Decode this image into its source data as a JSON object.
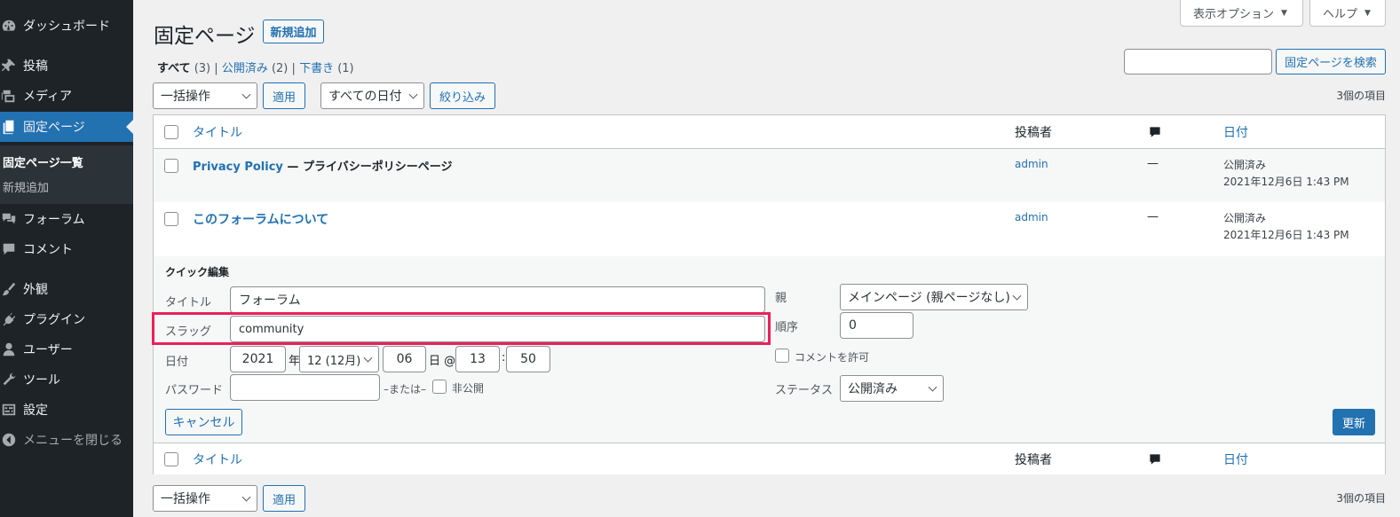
{
  "sidebar": {
    "items": [
      {
        "label": "ダッシュボード",
        "icon": "dashboard-icon"
      },
      {
        "label": "投稿",
        "icon": "pin-icon"
      },
      {
        "label": "メディア",
        "icon": "media-icon"
      },
      {
        "label": "固定ページ",
        "icon": "page-icon"
      },
      {
        "label": "フォーラム",
        "icon": "forum-icon"
      },
      {
        "label": "コメント",
        "icon": "comment-icon"
      },
      {
        "label": "外観",
        "icon": "brush-icon"
      },
      {
        "label": "プラグイン",
        "icon": "plugin-icon"
      },
      {
        "label": "ユーザー",
        "icon": "user-icon"
      },
      {
        "label": "ツール",
        "icon": "wrench-icon"
      },
      {
        "label": "設定",
        "icon": "settings-icon"
      },
      {
        "label": "メニューを閉じる",
        "icon": "collapse-icon"
      }
    ],
    "submenu": [
      "固定ページ一覧",
      "新規追加"
    ]
  },
  "header": {
    "screen_options": "表示オプション",
    "help": "ヘルプ",
    "title": "固定ページ",
    "add_new": "新規追加"
  },
  "filters": {
    "all": "すべて",
    "all_count": "(3)",
    "published": "公開済み",
    "published_count": "(2)",
    "draft": "下書き",
    "draft_count": "(1)",
    "sep": "|"
  },
  "search": {
    "value": "",
    "button": "固定ページを検索"
  },
  "bulk": {
    "action": "一括操作",
    "apply": "適用",
    "date": "すべての日付",
    "filter": "絞り込み",
    "count": "3個の項目"
  },
  "table": {
    "headers": {
      "title": "タイトル",
      "author": "投稿者",
      "date": "日付"
    },
    "rows": [
      {
        "title": "Privacy Policy",
        "state": " — プライバシーポリシーページ",
        "author": "admin",
        "comments": "—",
        "status": "公開済み",
        "datetime": "2021年12月6日 1:43 PM"
      },
      {
        "title": "このフォーラムについて",
        "state": "",
        "author": "admin",
        "comments": "—",
        "status": "公開済み",
        "datetime": "2021年12月6日 1:43 PM"
      }
    ]
  },
  "quick_edit": {
    "heading": "クイック編集",
    "title_label": "タイトル",
    "title_value": "フォーラム",
    "slug_label": "スラッグ",
    "slug_value": "community",
    "date_label": "日付",
    "year": "2021",
    "year_suffix": "年",
    "month": "12 (12月)",
    "day": "06",
    "day_suffix": "日 @",
    "hour": "13",
    "colon": ":",
    "minute": "50",
    "password_label": "パスワード",
    "password_value": "",
    "or_label": "–または–",
    "private_label": "非公開",
    "parent_label": "親",
    "parent_value": "メインページ (親ページなし)",
    "order_label": "順序",
    "order_value": "0",
    "allow_comments": "コメントを許可",
    "status_label": "ステータス",
    "status_value": "公開済み",
    "cancel": "キャンセル",
    "update": "更新"
  },
  "colors": {
    "accent": "#2271b1",
    "sidebar": "#1d2327",
    "highlight": "#ec1f5b"
  }
}
